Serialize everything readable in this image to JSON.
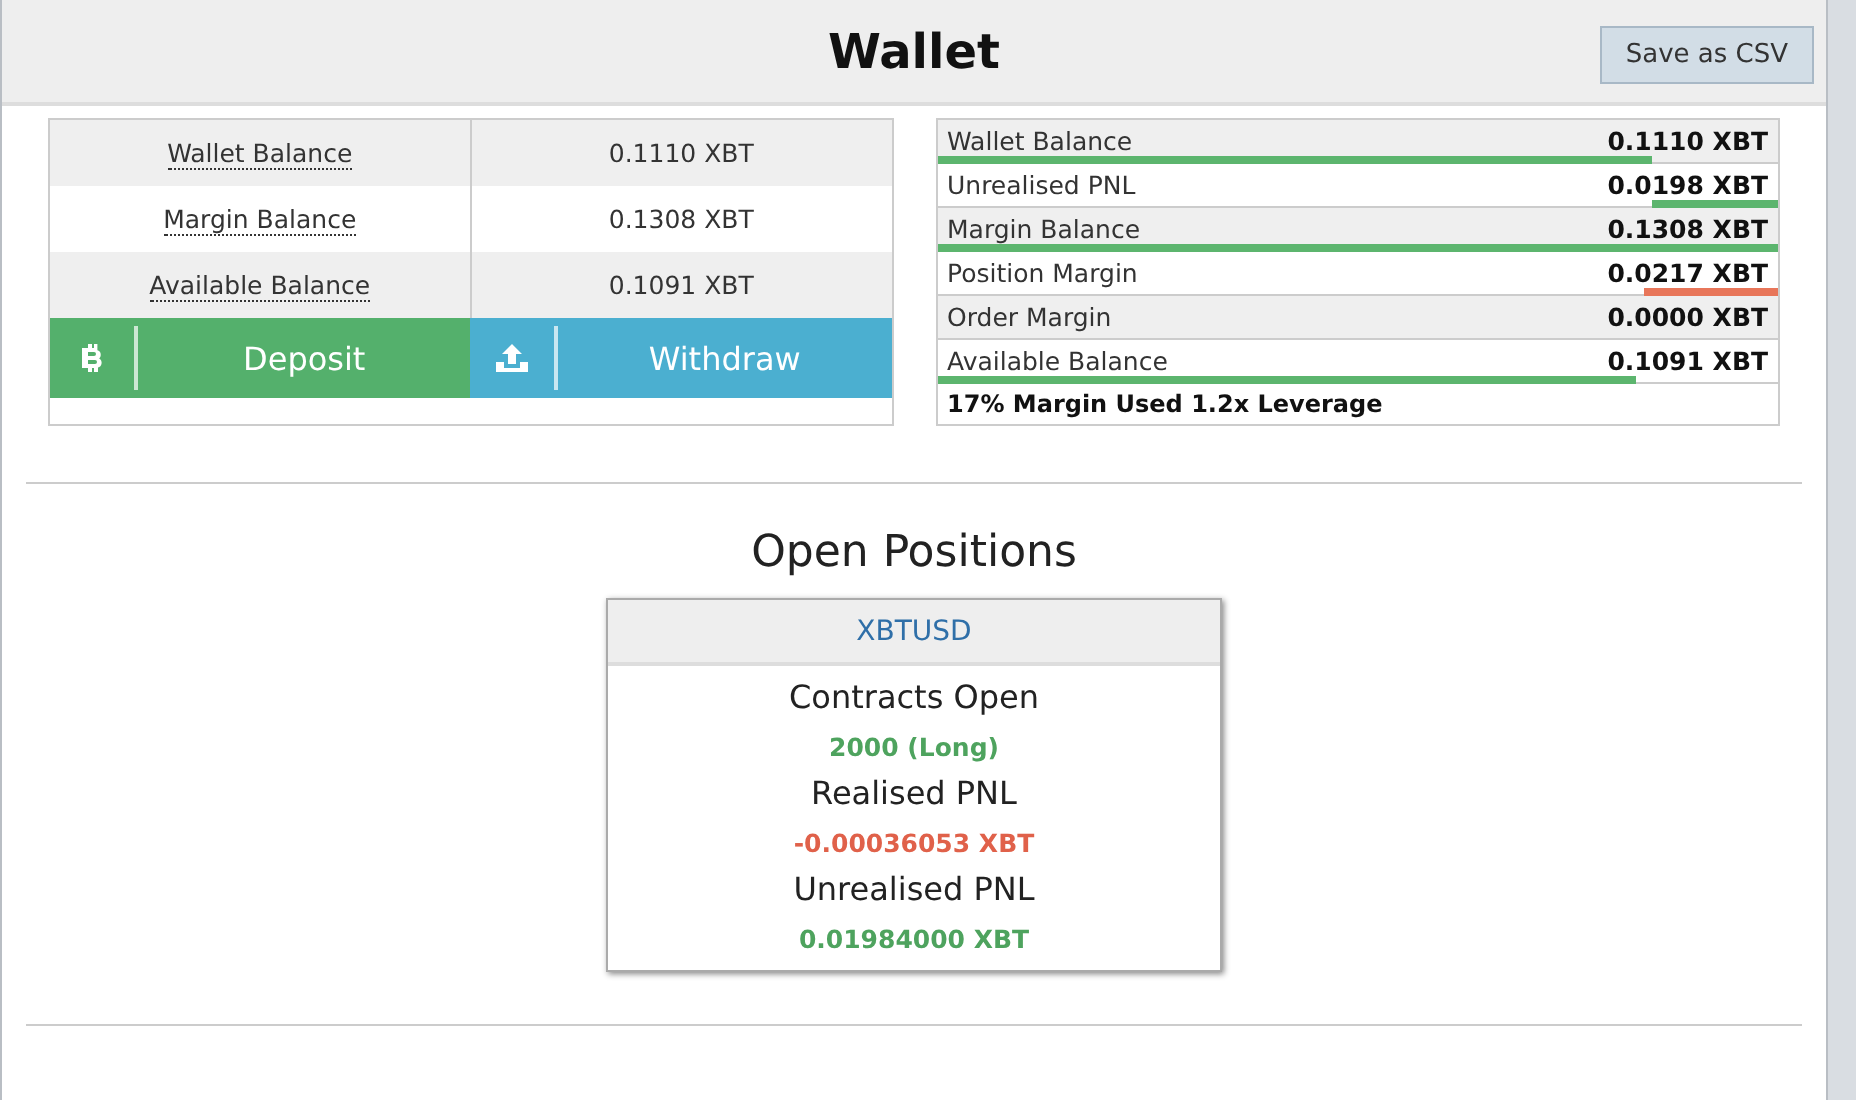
{
  "header": {
    "title": "Wallet",
    "save_button": "Save as CSV"
  },
  "summary": [
    {
      "label": "Wallet Balance",
      "value": "0.1110 XBT"
    },
    {
      "label": "Margin Balance",
      "value": "0.1308 XBT"
    },
    {
      "label": "Available Balance",
      "value": "0.1091 XBT"
    }
  ],
  "actions": [
    {
      "kind": "deposit",
      "label": "Deposit"
    },
    {
      "kind": "withdraw",
      "label": "Withdraw"
    }
  ],
  "breakdown": [
    {
      "label": "Wallet Balance",
      "value": "0.1110 XBT",
      "level": 0.85,
      "kind": "left",
      "color": "#5cb56e"
    },
    {
      "label": "Unrealised PNL",
      "value": "0.0198 XBT",
      "level": 0.15,
      "kind": "right",
      "color": "#5cb56e"
    },
    {
      "label": "Margin Balance",
      "value": "0.1308 XBT",
      "level": 1.0,
      "kind": "left",
      "color": "#5cb56e"
    },
    {
      "label": "Position Margin",
      "value": "0.0217 XBT",
      "level": 0.16,
      "kind": "right",
      "color": "#e8765a"
    },
    {
      "label": "Order Margin",
      "value": "0.0000 XBT"
    },
    {
      "label": "Available Balance",
      "value": "0.1091 XBT",
      "level": 0.83,
      "kind": "left",
      "color": "#5cb56e"
    }
  ],
  "breakdown_footer": "17% Margin Used 1.2x Leverage",
  "open_positions": {
    "title": "Open Positions",
    "positions": [
      {
        "symbol": "XBTUSD",
        "stats": [
          {
            "label": "Contracts Open",
            "value": "2000 (Long)",
            "color": "#4ea35e"
          },
          {
            "label": "Realised PNL",
            "value": "-0.00036053 XBT",
            "color": "#e0614a"
          },
          {
            "label": "Unrealised PNL",
            "value": "0.01984000 XBT",
            "color": "#4ea35e"
          }
        ]
      }
    ]
  }
}
